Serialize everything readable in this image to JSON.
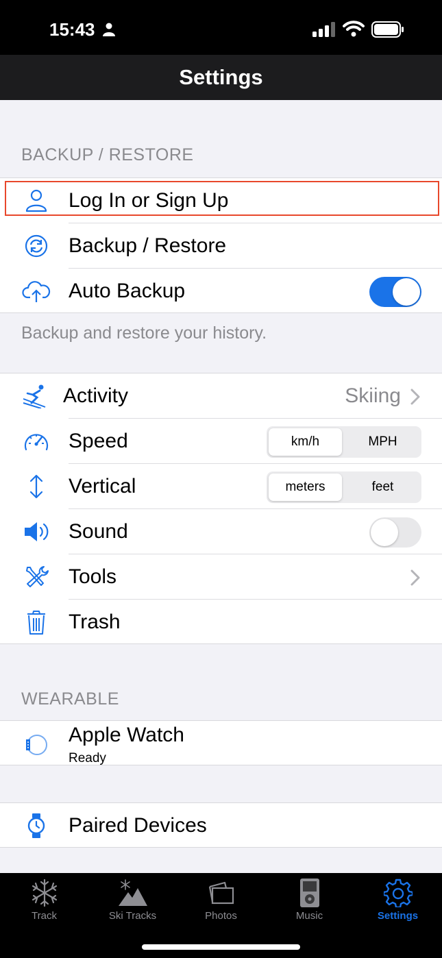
{
  "status": {
    "time": "15:43"
  },
  "nav": {
    "title": "Settings"
  },
  "backup": {
    "header": "BACKUP / RESTORE",
    "rows": [
      {
        "label": "Log In or Sign Up"
      },
      {
        "label": "Backup / Restore"
      },
      {
        "label": "Auto Backup",
        "toggle": "on"
      }
    ],
    "footer": "Backup and restore your history."
  },
  "general": {
    "activity": {
      "label": "Activity",
      "value": "Skiing"
    },
    "speed": {
      "label": "Speed",
      "options": [
        "km/h",
        "MPH"
      ],
      "selected": "km/h"
    },
    "vertical": {
      "label": "Vertical",
      "options": [
        "meters",
        "feet"
      ],
      "selected": "meters"
    },
    "sound": {
      "label": "Sound",
      "toggle": "off"
    },
    "tools": {
      "label": "Tools"
    },
    "trash": {
      "label": "Trash"
    }
  },
  "wearable": {
    "header": "WEARABLE",
    "apple_watch": {
      "label": "Apple Watch",
      "status": "Ready"
    },
    "paired": {
      "label": "Paired Devices"
    }
  },
  "tabs": [
    {
      "label": "Track",
      "icon": "snowflake-icon"
    },
    {
      "label": "Ski Tracks",
      "icon": "mountain-icon"
    },
    {
      "label": "Photos",
      "icon": "photos-icon"
    },
    {
      "label": "Music",
      "icon": "ipod-icon"
    },
    {
      "label": "Settings",
      "icon": "gear-icon",
      "active": true
    }
  ],
  "colors": {
    "accent": "#1a73e8",
    "highlight": "#e8472b"
  }
}
